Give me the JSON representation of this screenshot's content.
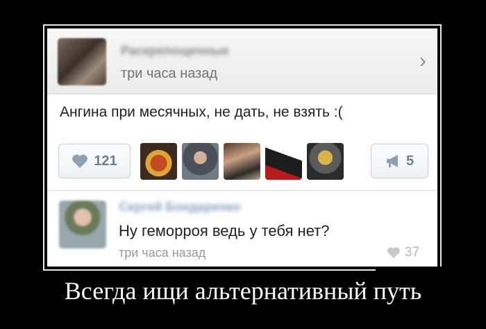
{
  "post": {
    "author_blurred": "Раскрепощенные",
    "time": "три часа назад",
    "text": "Ангина при месячных, не дать, не взять :(",
    "likes": "121",
    "shares": "5"
  },
  "comment": {
    "author_blurred": "Сергей Бондаренко",
    "text": "Ну геморроя ведь у тебя нет?",
    "time": "три часа назад",
    "likes": "37"
  },
  "caption": "Всегда ищи альтернативный путь",
  "colors": {
    "accent": "#6e7f93",
    "background": "#000000",
    "card": "#ffffff"
  }
}
